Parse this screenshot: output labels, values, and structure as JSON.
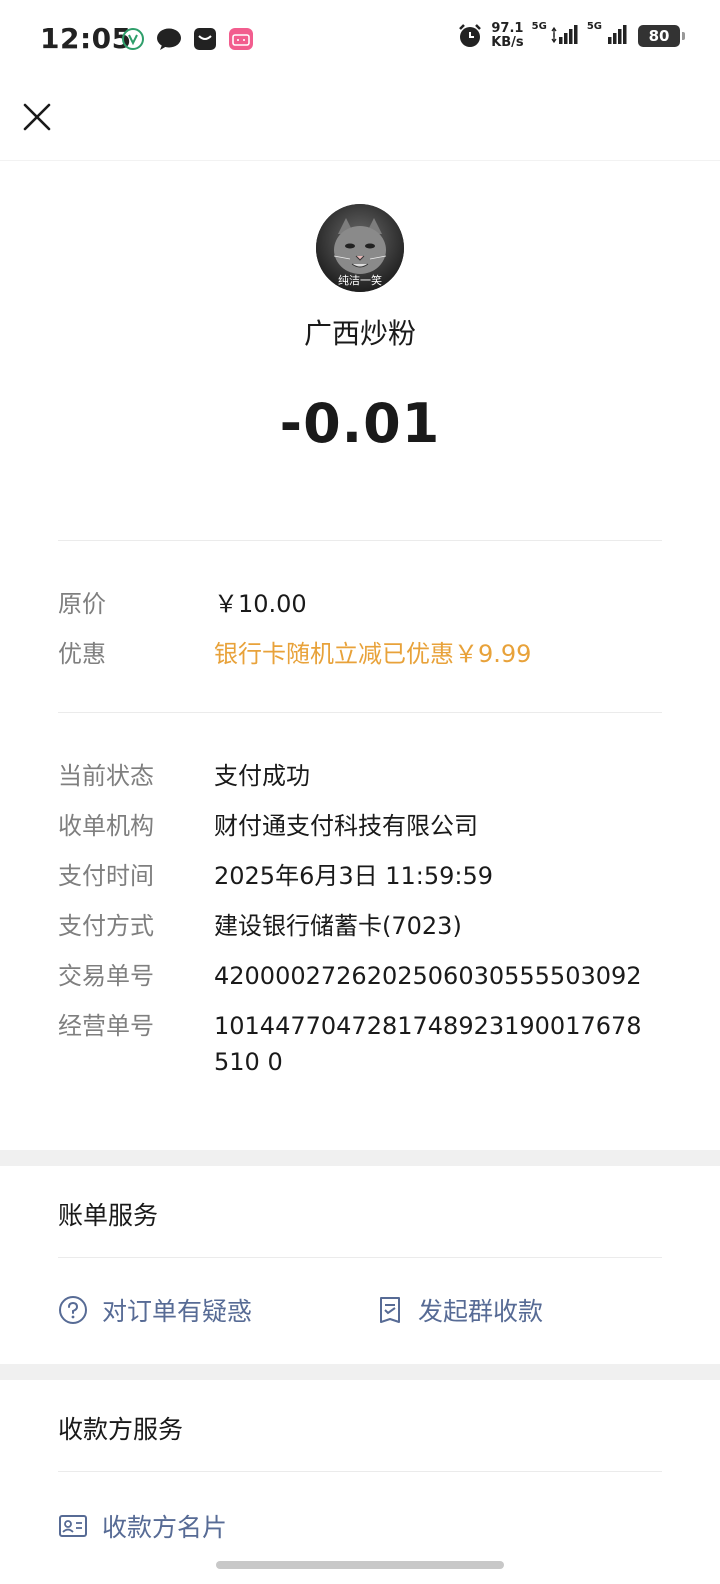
{
  "status_bar": {
    "time": "12:05",
    "net_speed_value": "97.1",
    "net_speed_unit": "KB/s",
    "signal1_label": "5G",
    "signal2_label": "5G",
    "battery": "80",
    "left_icons": [
      "vpn-icon",
      "chat-bubble-icon",
      "mail-app-icon",
      "bilibili-icon"
    ]
  },
  "merchant": {
    "avatar_caption": "纯洁一笑",
    "name": "广西炒粉",
    "amount": "-0.01"
  },
  "pricing": [
    {
      "label": "原价",
      "value": "￥10.00"
    },
    {
      "label": "优惠",
      "value": "银行卡随机立减已优惠￥9.99"
    }
  ],
  "details": [
    {
      "label": "当前状态",
      "value": "支付成功"
    },
    {
      "label": "收单机构",
      "value": "财付通支付科技有限公司"
    },
    {
      "label": "支付时间",
      "value": "2025年6月3日 11:59:59"
    },
    {
      "label": "支付方式",
      "value": "建设银行储蓄卡(7023)"
    },
    {
      "label": "交易单号",
      "value": "4200002726202506030555503092"
    },
    {
      "label": "经营单号",
      "value": "1014477047281748923190017678510 0"
    }
  ],
  "bill_service": {
    "title": "账单服务",
    "question_label": "对订单有疑惑",
    "group_collect_label": "发起群收款"
  },
  "payee_service": {
    "title": "收款方服务",
    "business_card_label": "收款方名片"
  },
  "colors": {
    "link": "#576b95",
    "discount": "#e8a23a",
    "label": "#7f7f7f"
  }
}
